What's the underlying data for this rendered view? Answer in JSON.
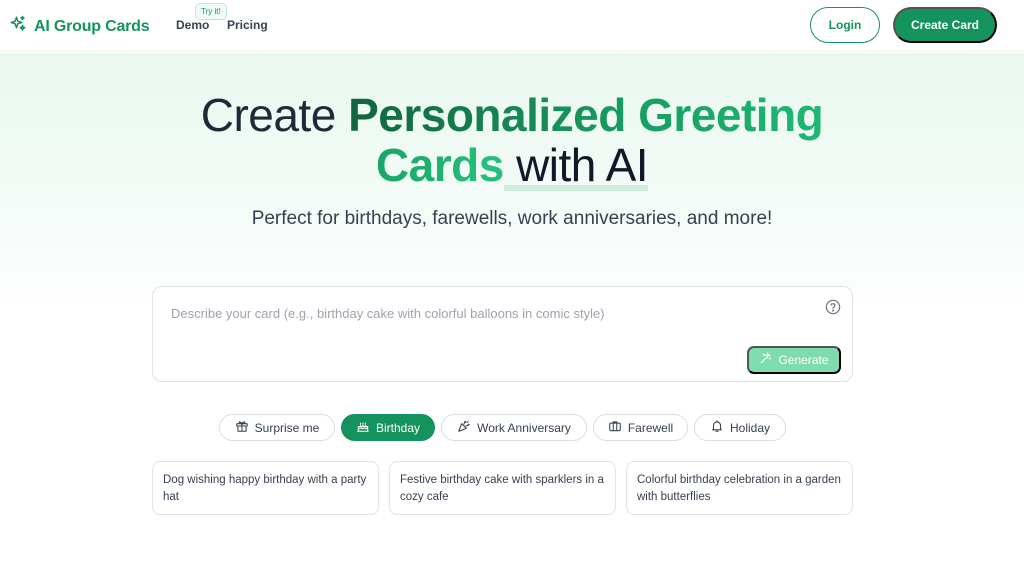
{
  "brand": {
    "name": "AI Group Cards",
    "icon": "sparkles-icon",
    "color": "#15935e"
  },
  "nav": {
    "demo": "Demo",
    "demo_badge": "Try it!",
    "pricing": "Pricing"
  },
  "header_actions": {
    "login": "Login",
    "create_card": "Create Card"
  },
  "hero": {
    "title_part1": "Create ",
    "title_highlight1": "Personalized Greeting",
    "title_highlight2": "Cards",
    "title_part2": " with AI",
    "subtitle": "Perfect for birthdays, farewells, work anniversaries, and more!"
  },
  "prompt": {
    "placeholder": "Describe your card (e.g., birthday cake with colorful balloons in comic style)",
    "value": "",
    "generate_label": "Generate"
  },
  "occasions": [
    {
      "label": "Surprise me",
      "icon": "gift-icon",
      "active": false
    },
    {
      "label": "Birthday",
      "icon": "cake-icon",
      "active": true
    },
    {
      "label": "Work Anniversary",
      "icon": "party-popper-icon",
      "active": false
    },
    {
      "label": "Farewell",
      "icon": "briefcase-icon",
      "active": false
    },
    {
      "label": "Holiday",
      "icon": "bell-icon",
      "active": false
    }
  ],
  "suggestions": [
    "Dog wishing happy birthday with a party hat",
    "Festive birthday cake with sparklers in a cozy cafe",
    "Colorful birthday celebration in a garden with butterflies"
  ]
}
